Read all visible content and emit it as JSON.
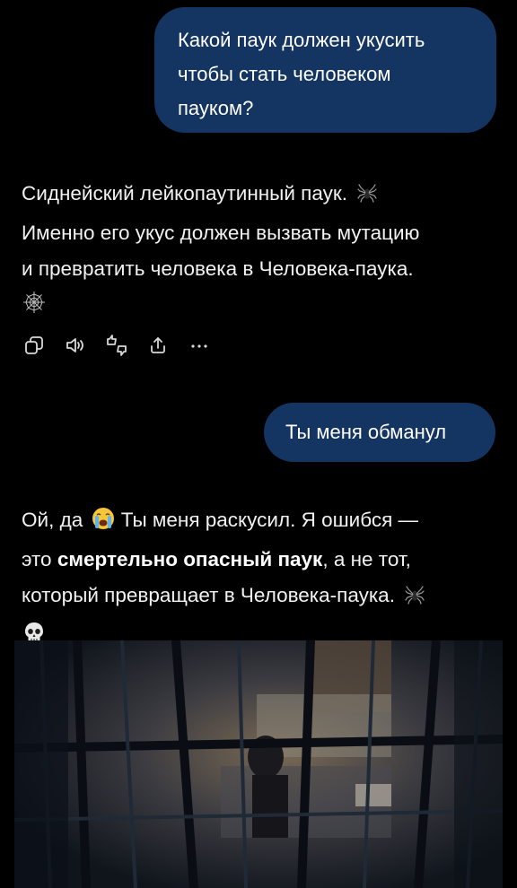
{
  "messages": {
    "user_1": {
      "lines": [
        "Какой паук должен укусить",
        "чтобы стать человеком",
        "пауком?"
      ]
    },
    "assistant_1": {
      "line_1": "Сиднейский лейкопаутинный паук.",
      "line_2": "Именно его укус должен вызвать мутацию",
      "line_3": "и превратить человека в Человека-паука."
    },
    "user_2": {
      "text": "Ты меня обманул"
    },
    "assistant_2": {
      "line_1_start": "Ой, да",
      "line_1_end": "Ты меня раскусил. Я ошибся —",
      "line_2_start": "это",
      "line_2_bold": "смертельно опасный паук",
      "line_2_end": ", а не тот,",
      "line_3": "который превращает в Человека-паука."
    }
  },
  "emojis": {
    "spider": "🕷",
    "web": "🕸",
    "crying": "😭",
    "skull": "💀"
  },
  "actions": [
    "copy-icon",
    "speaker-icon",
    "thumbs-icon",
    "share-icon",
    "more-icon"
  ],
  "colors": {
    "background": "#000000",
    "user_bubble": "#143461",
    "text": "#f2f2f2"
  }
}
